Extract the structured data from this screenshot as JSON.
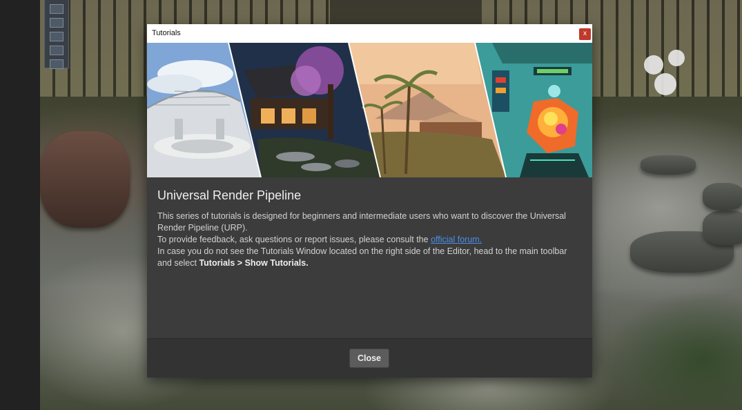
{
  "dialog": {
    "title": "Tutorials",
    "close_icon_glyph": "x",
    "heading": "Universal Render Pipeline",
    "paragraph1": "This series of tutorials is designed for beginners and intermediate users who want to discover the Universal Render Pipeline (URP).",
    "paragraph2_prefix": "To provide feedback, ask questions or report issues, please consult the ",
    "paragraph2_link": "official forum.",
    "paragraph3_prefix": "In case you do not see the Tutorials Window located on the right side of the Editor, head to the main toolbar and select ",
    "paragraph3_bold": "Tutorials > Show Tutorials.",
    "close_button": "Close"
  },
  "banner": {
    "panels": [
      "sky-dome-interior",
      "japanese-garden-night",
      "desert-oasis",
      "spaceship-cockpit"
    ]
  },
  "colors": {
    "link": "#4c8ee8",
    "close_icon_bg": "#c0392b",
    "dialog_bg": "#3c3c3c"
  }
}
